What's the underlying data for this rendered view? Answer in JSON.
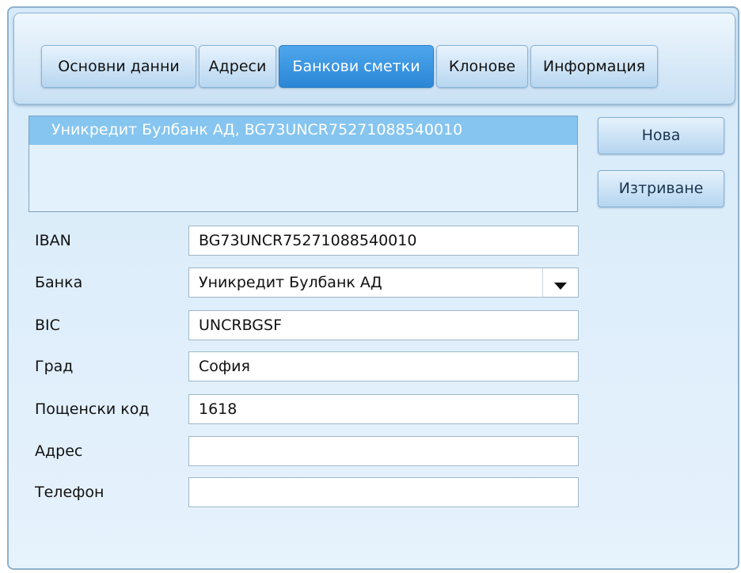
{
  "tabs": [
    {
      "label": "Основни данни",
      "active": false
    },
    {
      "label": "Адреси",
      "active": false
    },
    {
      "label": "Банкови сметки",
      "active": true
    },
    {
      "label": "Клонове",
      "active": false
    },
    {
      "label": "Информация",
      "active": false
    }
  ],
  "accounts": {
    "items": [
      "Уникредит Булбанк АД, BG73UNCR75271088540010"
    ],
    "selected_index": 0
  },
  "buttons": {
    "new_label": "Нова",
    "delete_label": "Изтриване"
  },
  "form": {
    "iban": {
      "label": "IBAN",
      "value": "BG73UNCR75271088540010"
    },
    "bank": {
      "label": "Банка",
      "value": "Уникредит Булбанк АД"
    },
    "bic": {
      "label": "BIC",
      "value": "UNCRBGSF"
    },
    "city": {
      "label": "Град",
      "value": "София"
    },
    "postal_code": {
      "label": "Пощенски код",
      "value": "1618"
    },
    "address": {
      "label": "Адрес",
      "value": ""
    },
    "phone": {
      "label": "Телефон",
      "value": ""
    }
  },
  "icons": {
    "dropdown": "caret-down-icon"
  },
  "colors": {
    "active_tab": "#3a97e2",
    "selected_row": "#86c5ef",
    "panel_background": "#d6eaf9"
  }
}
